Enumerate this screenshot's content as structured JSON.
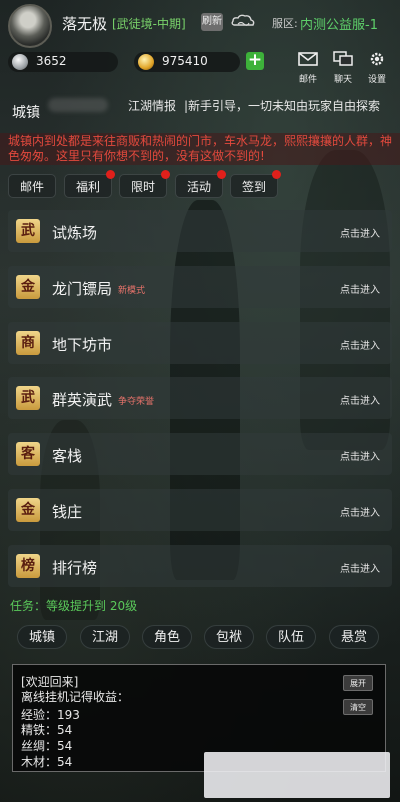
{
  "header": {
    "player_name": "落无极",
    "rank": "[武徒境-中期]",
    "refresh_label": "刷新",
    "server_label": "服区:",
    "server_name": "内测公益服-1"
  },
  "currency": {
    "silver": "3652",
    "gold": "975410"
  },
  "top_icons": {
    "mail_label": "邮件",
    "chat_label": "聊天",
    "settings_label": "设置"
  },
  "town": {
    "location_label": "城镇",
    "news_label": "江湖情报",
    "news_ticker": "|新手引导，一切未知由玩家自由探索",
    "description": "城镇内到处都是来往商贩和热闹的门市，车水马龙，熙熙攘攘的人群，神色匆匆。这里只有你想不到的，没有这做不到的!"
  },
  "quick_buttons": [
    {
      "label": "邮件",
      "dot": false
    },
    {
      "label": "福利",
      "dot": true
    },
    {
      "label": "限时",
      "dot": true
    },
    {
      "label": "活动",
      "dot": true
    },
    {
      "label": "签到",
      "dot": true
    }
  ],
  "menu": [
    {
      "badge": "武",
      "title": "试炼场",
      "tag": "",
      "enter": "点击进入"
    },
    {
      "badge": "金",
      "title": "龙门镖局",
      "tag": "新模式",
      "enter": "点击进入"
    },
    {
      "badge": "商",
      "title": "地下坊市",
      "tag": "",
      "enter": "点击进入"
    },
    {
      "badge": "武",
      "title": "群英演武",
      "tag": "争夺荣誉",
      "enter": "点击进入"
    },
    {
      "badge": "客",
      "title": "客栈",
      "tag": "",
      "enter": "点击进入"
    },
    {
      "badge": "金",
      "title": "钱庄",
      "tag": "",
      "enter": "点击进入"
    },
    {
      "badge": "榜",
      "title": "排行榜",
      "tag": "",
      "enter": "点击进入"
    }
  ],
  "task": {
    "text": "任务：等级提升到 20级"
  },
  "bottom_nav": [
    "城镇",
    "江湖",
    "角色",
    "包袱",
    "队伍",
    "悬赏"
  ],
  "log": {
    "lines": [
      "[欢迎回来]",
      "离线挂机记得收益：",
      "经验：193",
      "精铁：54",
      "丝绸：54",
      "木材：54"
    ],
    "expand_label": "展开",
    "clear_label": "清空"
  },
  "colors": {
    "accent_green": "#5ed06a",
    "alert_red": "#e2493d",
    "badge_gold": "#d9b25a"
  }
}
